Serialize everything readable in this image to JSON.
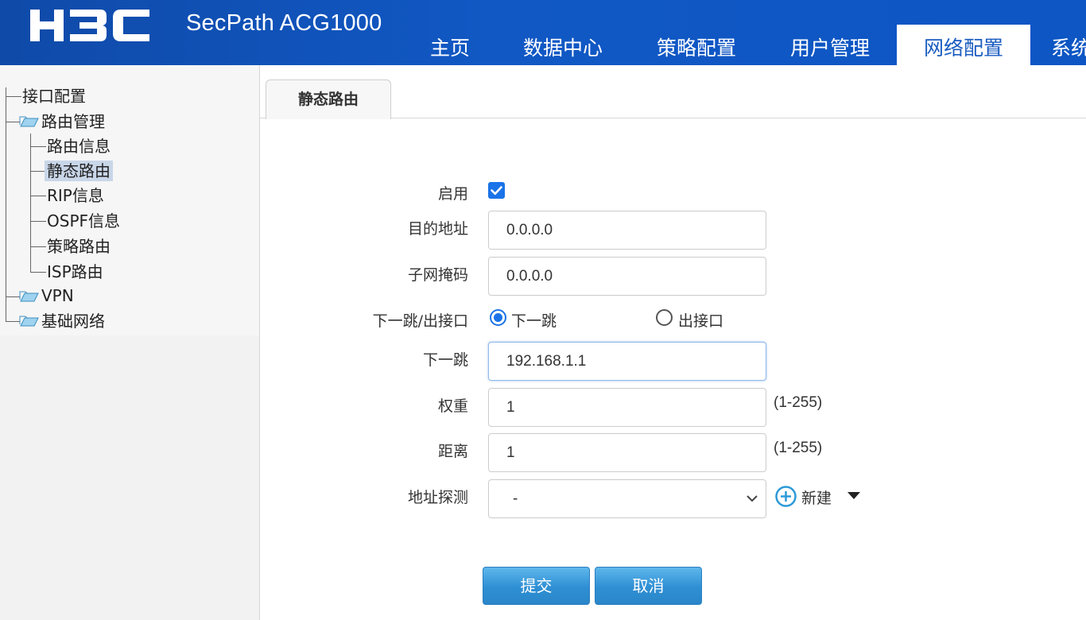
{
  "header": {
    "logo_text": "H3C",
    "product_name": "SecPath ACG1000",
    "nav_tabs": [
      {
        "label": "主页"
      },
      {
        "label": "数据中心"
      },
      {
        "label": "策略配置"
      },
      {
        "label": "用户管理"
      },
      {
        "label": "网络配置",
        "active": true
      },
      {
        "label": "系统"
      }
    ]
  },
  "sidebar": {
    "tree": [
      {
        "label": "接口配置"
      },
      {
        "label": "路由管理",
        "expanded": true,
        "children": [
          {
            "label": "路由信息"
          },
          {
            "label": "静态路由",
            "selected": true
          },
          {
            "label": "RIP信息"
          },
          {
            "label": "OSPF信息"
          },
          {
            "label": "策略路由"
          },
          {
            "label": "ISP路由"
          }
        ]
      },
      {
        "label": "VPN"
      },
      {
        "label": "基础网络"
      }
    ]
  },
  "main": {
    "tab_label": "静态路由",
    "form": {
      "enable_label": "启用",
      "enable_checked": true,
      "dest_label": "目的地址",
      "dest_value": "0.0.0.0",
      "mask_label": "子网掩码",
      "mask_value": "0.0.0.0",
      "mode_label": "下一跳/出接口",
      "mode_option_nexthop": "下一跳",
      "mode_option_iface": "出接口",
      "mode_selected": "下一跳",
      "nexthop_label": "下一跳",
      "nexthop_value": "192.168.1.1",
      "weight_label": "权重",
      "weight_value": "1",
      "weight_hint": "(1-255)",
      "distance_label": "距离",
      "distance_value": "1",
      "distance_hint": "(1-255)",
      "probe_label": "地址探测",
      "probe_value": "-",
      "new_label": "新建"
    },
    "buttons": {
      "submit": "提交",
      "cancel": "取消"
    }
  },
  "colors": {
    "header_blue": "#1158c4",
    "accent_blue": "#1a73e8",
    "button_blue": "#2f8fd3"
  }
}
